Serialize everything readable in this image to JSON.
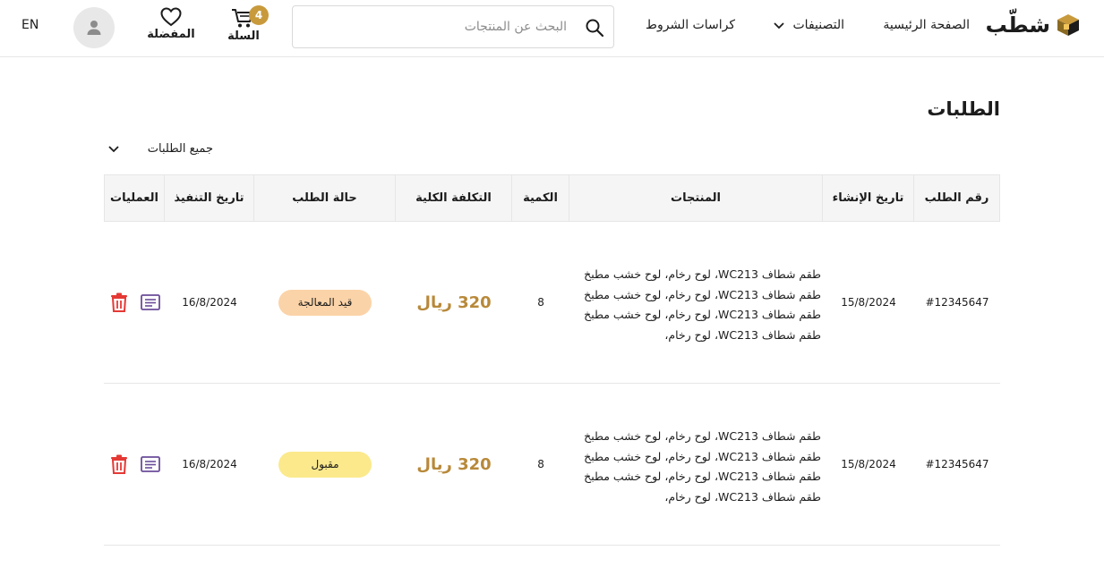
{
  "brand": {
    "name": "شطّب",
    "logo_icon": "box-logo-icon"
  },
  "nav": {
    "home": "الصفحة الرئيسية",
    "categories": "التصنيفات",
    "terms": "كراسات الشروط"
  },
  "search": {
    "placeholder": "البحث عن المنتجات",
    "value": ""
  },
  "cart": {
    "label": "السلة",
    "count": "4"
  },
  "favorites": {
    "label": "المفضلة"
  },
  "language": "EN",
  "page": {
    "title": "الطلبات",
    "filter_label": "جميع الطلبات"
  },
  "table": {
    "headers": {
      "order_no": "رقم الطلب",
      "created": "تاريخ الإنشاء",
      "products": "المنتجات",
      "qty": "الكمية",
      "total": "التكلفة الكلية",
      "status": "حالة الطلب",
      "executed": "تاريخ التنفيذ",
      "actions": "العمليات"
    },
    "rows": [
      {
        "order_no": "#12345647",
        "created": "15/8/2024",
        "products": [
          "طقم شطاف WC213، لوح رخام، لوح خشب مطبخ",
          "طقم شطاف WC213، لوح رخام، لوح خشب مطبخ",
          "طقم شطاف WC213، لوح رخام، لوح خشب مطبخ",
          "طقم شطاف WC213، لوح رخام،"
        ],
        "qty": "8",
        "total": "320 ريال",
        "status": "قيد المعالجة",
        "status_color": "#fbd3a8",
        "executed": "16/8/2024"
      },
      {
        "order_no": "#12345647",
        "created": "15/8/2024",
        "products": [
          "طقم شطاف WC213، لوح رخام، لوح خشب مطبخ",
          "طقم شطاف WC213، لوح رخام، لوح خشب مطبخ",
          "طقم شطاف WC213، لوح رخام، لوح خشب مطبخ",
          "طقم شطاف WC213، لوح رخام،"
        ],
        "qty": "8",
        "total": "320 ريال",
        "status": "مقبول",
        "status_color": "#fbe98c",
        "executed": "16/8/2024"
      }
    ]
  },
  "colors": {
    "accent": "#c89a3c",
    "price": "#b8893a",
    "delete": "#e53935",
    "details": "#6b4c9a"
  }
}
